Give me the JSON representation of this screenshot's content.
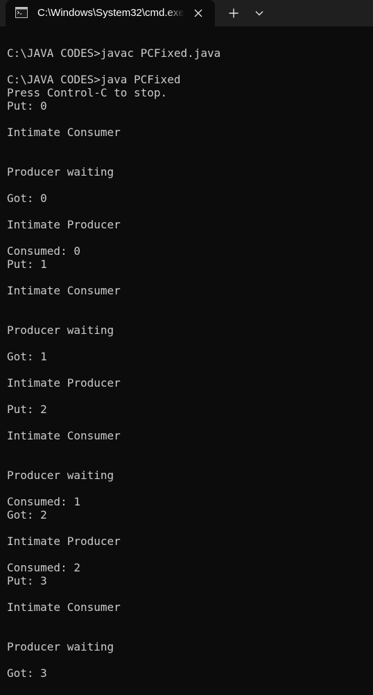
{
  "tab": {
    "title": "C:\\Windows\\System32\\cmd.exe",
    "icon": "cmd-icon"
  },
  "colors": {
    "titlebar": "#1f1f1f",
    "background": "#0c0c0c",
    "text": "#cccccc"
  },
  "console": {
    "lines": [
      "C:\\JAVA CODES>javac PCFixed.java",
      "",
      "C:\\JAVA CODES>java PCFixed",
      "Press Control-C to stop.",
      "Put: 0",
      "",
      "Intimate Consumer",
      "",
      "",
      "Producer waiting",
      "",
      "Got: 0",
      "",
      "Intimate Producer",
      "",
      "Consumed: 0",
      "Put: 1",
      "",
      "Intimate Consumer",
      "",
      "",
      "Producer waiting",
      "",
      "Got: 1",
      "",
      "Intimate Producer",
      "",
      "Put: 2",
      "",
      "Intimate Consumer",
      "",
      "",
      "Producer waiting",
      "",
      "Consumed: 1",
      "Got: 2",
      "",
      "Intimate Producer",
      "",
      "Consumed: 2",
      "Put: 3",
      "",
      "Intimate Consumer",
      "",
      "",
      "Producer waiting",
      "",
      "Got: 3"
    ]
  }
}
